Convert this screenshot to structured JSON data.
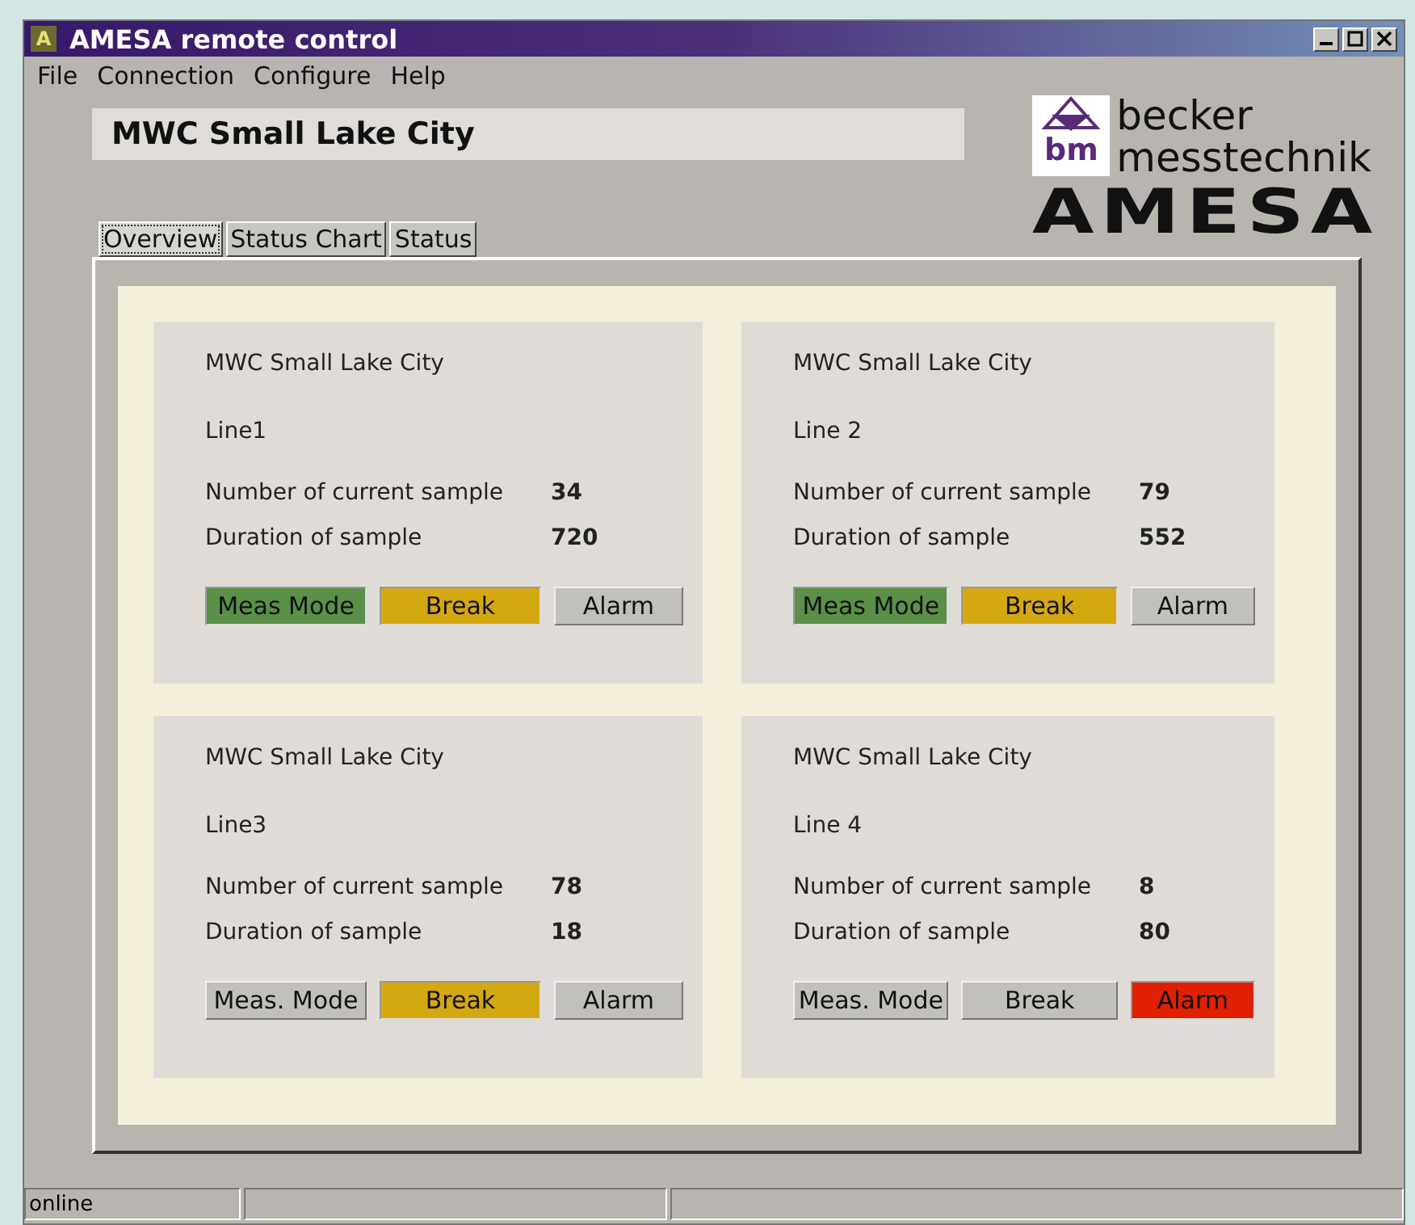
{
  "window": {
    "title": "AMESA remote control",
    "app_icon": "A"
  },
  "menu": [
    "File",
    "Connection",
    "Configure",
    "Help"
  ],
  "site_name": "MWC Small Lake City",
  "logo": {
    "mark": "bm",
    "line1": "becker",
    "line2": "messtechnik",
    "product": "AMESA"
  },
  "tabs": [
    {
      "label": "Overview",
      "selected": true
    },
    {
      "label": "Status Chart",
      "selected": false
    },
    {
      "label": "Status",
      "selected": false
    }
  ],
  "cards": [
    {
      "site": "MWC Small Lake City",
      "line": "Line1",
      "sample_label": "Number of current sample",
      "sample": "34",
      "duration_label": "Duration of sample",
      "duration": "720",
      "indicators": [
        {
          "label": "Meas  Mode",
          "on": true,
          "color": "#5a9048"
        },
        {
          "label": "Break",
          "on": true,
          "color": "#d4a810"
        },
        {
          "label": "Alarm",
          "on": false
        }
      ]
    },
    {
      "site": "MWC Small Lake City",
      "line": "Line  2",
      "sample_label": "Number of current  sample",
      "sample": "79",
      "duration_label": "Duration of sample",
      "duration": "552",
      "indicators": [
        {
          "label": "Meas  Mode",
          "on": true,
          "color": "#5a9048"
        },
        {
          "label": "Break",
          "on": true,
          "color": "#d4a810"
        },
        {
          "label": "Alarm",
          "on": false
        }
      ]
    },
    {
      "site": "MWC Small Lake City",
      "line": "Line3",
      "sample_label": "Number of current  sample",
      "sample": "78",
      "duration_label": "Duration of sample",
      "duration": "18",
      "indicators": [
        {
          "label": "Meas. Mode",
          "on": false
        },
        {
          "label": "Break",
          "on": true,
          "color": "#d4a810"
        },
        {
          "label": "Alarm",
          "on": false
        }
      ]
    },
    {
      "site": "MWC Small Lake City",
      "line": "Line  4",
      "sample_label": "Number of current  sample",
      "sample": "8",
      "duration_label": "Duration of sample",
      "duration": "80",
      "indicators": [
        {
          "label": "Meas. Mode",
          "on": false
        },
        {
          "label": "Break",
          "on": false
        },
        {
          "label": "Alarm",
          "on": true,
          "color": "#e02000"
        }
      ]
    }
  ],
  "status_bar": [
    "online"
  ]
}
